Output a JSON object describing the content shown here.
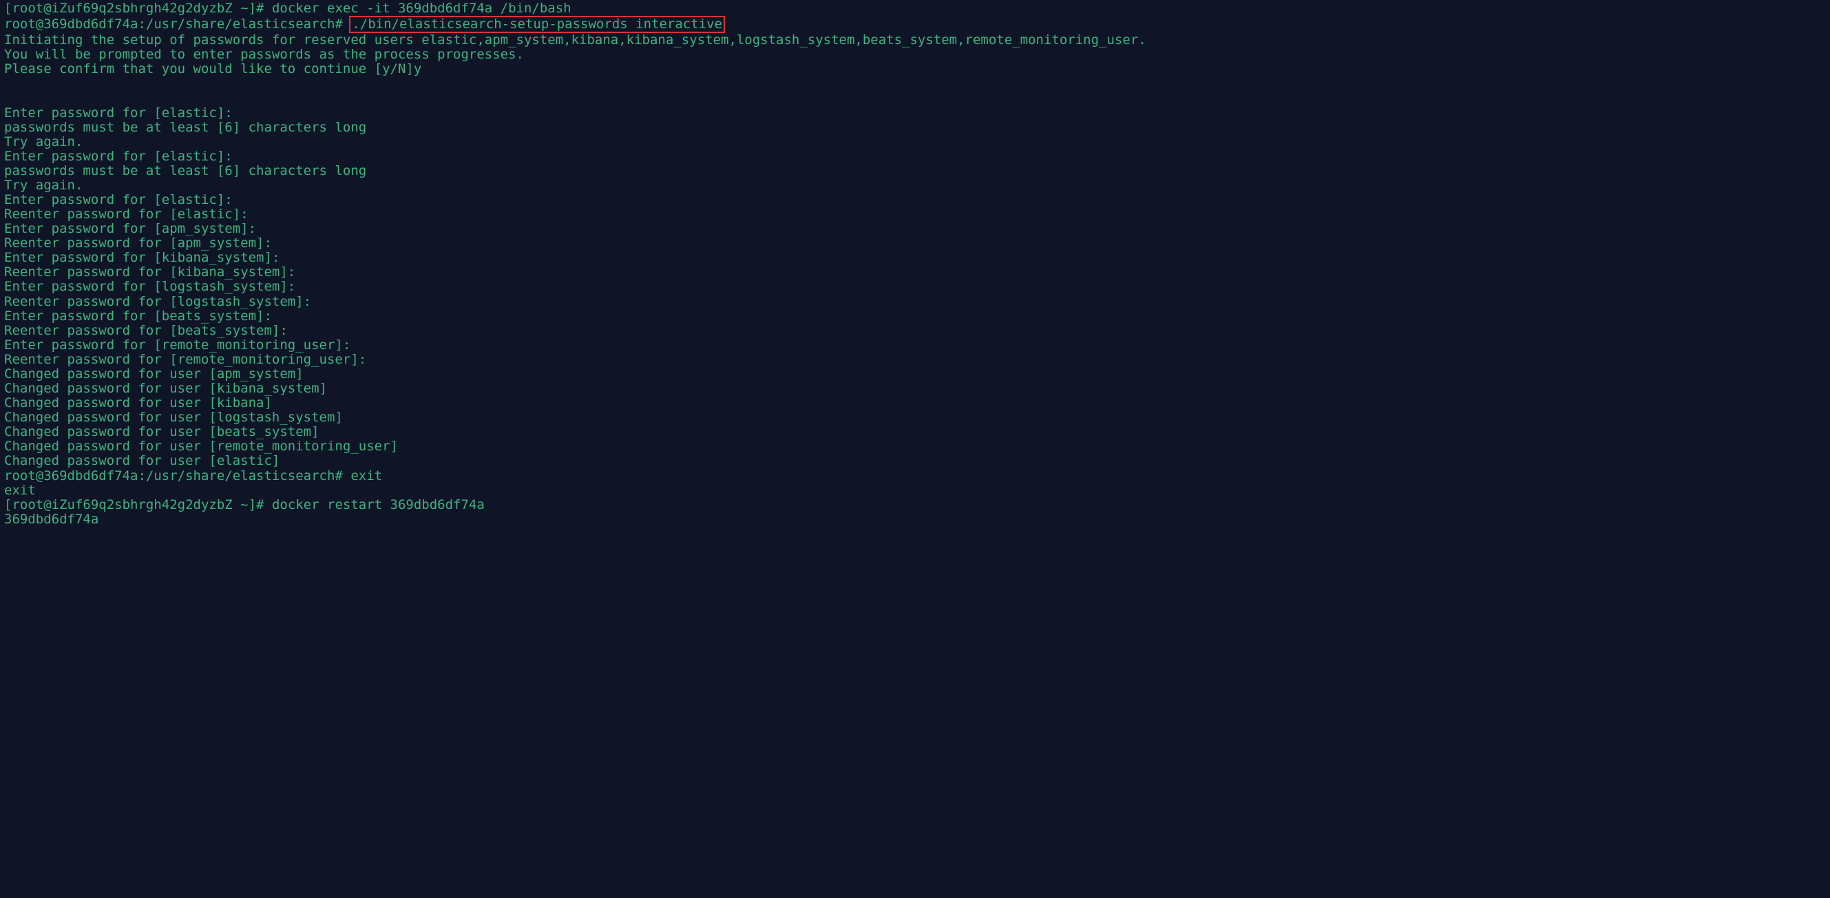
{
  "lines": [
    {
      "prompt": "[root@iZuf69q2sbhrgh42g2dyzbZ ~]# ",
      "cmd": "docker exec -it 369dbd6df74a /bin/bash",
      "highlight": false
    },
    {
      "prompt": "root@369dbd6df74a:/usr/share/elasticsearch# ",
      "cmd": "./bin/elasticsearch-setup-passwords interactive",
      "highlight": true
    },
    {
      "text": "Initiating the setup of passwords for reserved users elastic,apm_system,kibana,kibana_system,logstash_system,beats_system,remote_monitoring_user."
    },
    {
      "text": "You will be prompted to enter passwords as the process progresses."
    },
    {
      "text": "Please confirm that you would like to continue [y/N]y"
    },
    {
      "text": ""
    },
    {
      "text": ""
    },
    {
      "text": "Enter password for [elastic]: "
    },
    {
      "text": "passwords must be at least [6] characters long"
    },
    {
      "text": "Try again."
    },
    {
      "text": "Enter password for [elastic]: "
    },
    {
      "text": "passwords must be at least [6] characters long"
    },
    {
      "text": "Try again."
    },
    {
      "text": "Enter password for [elastic]: "
    },
    {
      "text": "Reenter password for [elastic]: "
    },
    {
      "text": "Enter password for [apm_system]: "
    },
    {
      "text": "Reenter password for [apm_system]: "
    },
    {
      "text": "Enter password for [kibana_system]: "
    },
    {
      "text": "Reenter password for [kibana_system]: "
    },
    {
      "text": "Enter password for [logstash_system]: "
    },
    {
      "text": "Reenter password for [logstash_system]: "
    },
    {
      "text": "Enter password for [beats_system]: "
    },
    {
      "text": "Reenter password for [beats_system]: "
    },
    {
      "text": "Enter password for [remote_monitoring_user]: "
    },
    {
      "text": "Reenter password for [remote_monitoring_user]: "
    },
    {
      "text": "Changed password for user [apm_system]"
    },
    {
      "text": "Changed password for user [kibana_system]"
    },
    {
      "text": "Changed password for user [kibana]"
    },
    {
      "text": "Changed password for user [logstash_system]"
    },
    {
      "text": "Changed password for user [beats_system]"
    },
    {
      "text": "Changed password for user [remote_monitoring_user]"
    },
    {
      "text": "Changed password for user [elastic]"
    },
    {
      "prompt": "root@369dbd6df74a:/usr/share/elasticsearch# ",
      "cmd": "exit",
      "highlight": false
    },
    {
      "text": "exit"
    },
    {
      "prompt": "[root@iZuf69q2sbhrgh42g2dyzbZ ~]# ",
      "cmd": "docker restart 369dbd6df74a",
      "highlight": false
    },
    {
      "text": "369dbd6df74a"
    }
  ]
}
